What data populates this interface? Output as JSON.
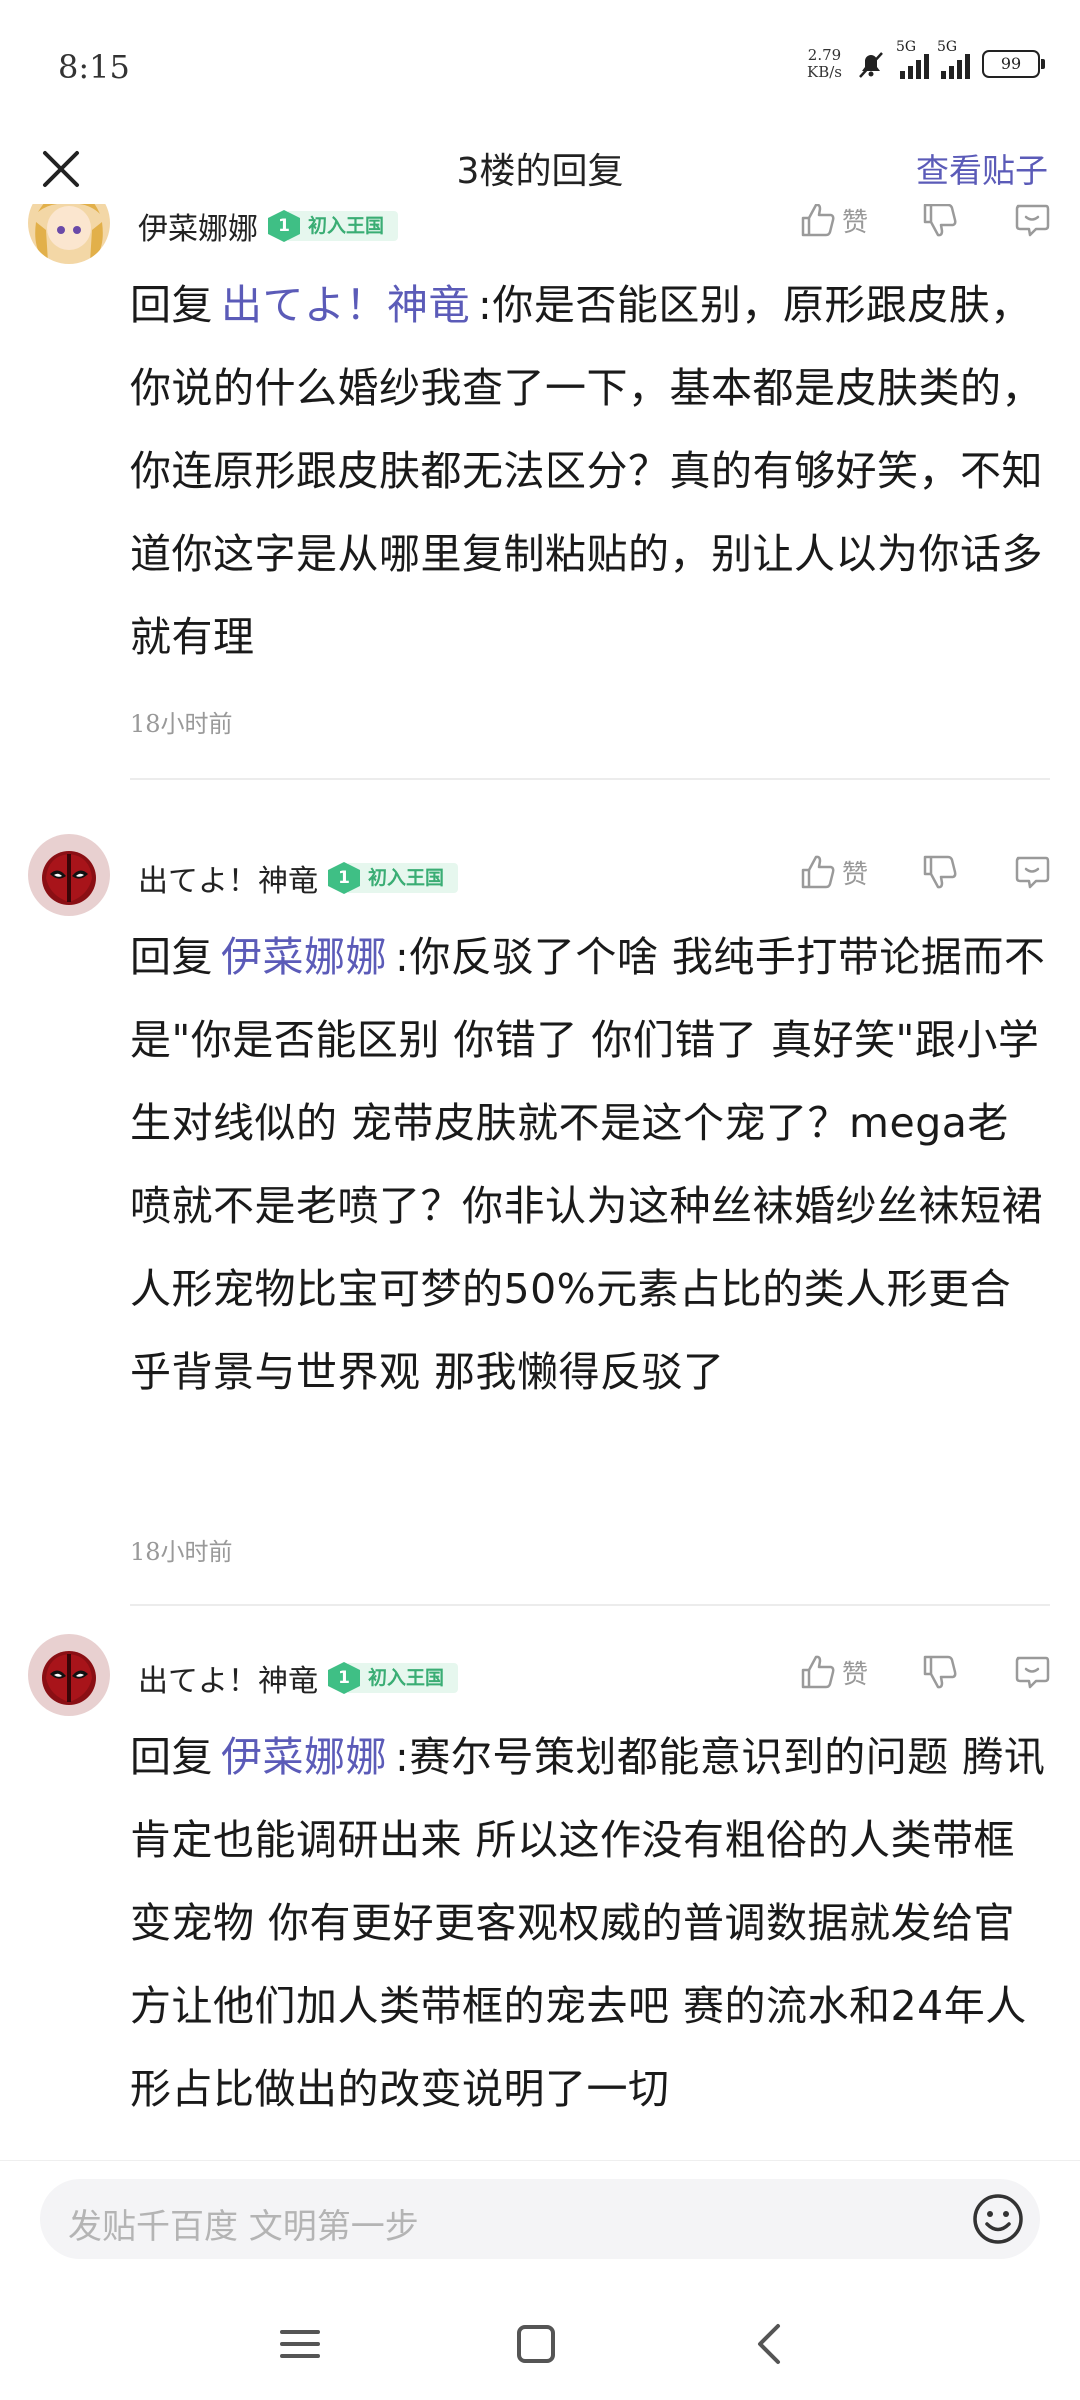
{
  "status_bar": {
    "time": "8:15",
    "speed_value": "2.79",
    "speed_unit": "KB/s",
    "net1": "5G",
    "net2": "5G",
    "battery": "99"
  },
  "header": {
    "title": "3楼的回复",
    "view_post": "查看贴子"
  },
  "comments": [
    {
      "username": "伊菜娜娜",
      "level": "1",
      "level_name": "初入王国",
      "like_label": "赞",
      "reply_prefix": "回复",
      "mention": "出てよ！神竜",
      "text": ":你是否能区别，原形跟皮肤，你说的什么婚纱我查了一下，基本都是皮肤类的，你连原形跟皮肤都无法区分？真的有够好笑，不知道你这字是从哪里复制粘贴的，别让人以为你话多就有理",
      "time": "18小时前"
    },
    {
      "username": "出てよ！神竜",
      "level": "1",
      "level_name": "初入王国",
      "like_label": "赞",
      "reply_prefix": "回复",
      "mention": "伊菜娜娜",
      "text": ":你反驳了个啥 我纯手打带论据而不是\"你是否能区别 你错了 你们错了 真好笑\"跟小学生对线似的 宠带皮肤就不是这个宠了？mega老喷就不是老喷了？你非认为这种丝袜婚纱丝袜短裙人形宠物比宝可梦的50%元素占比的类人形更合乎背景与世界观 那我懒得反驳了",
      "time": "18小时前"
    },
    {
      "username": "出てよ！神竜",
      "level": "1",
      "level_name": "初入王国",
      "like_label": "赞",
      "reply_prefix": "回复",
      "mention": "伊菜娜娜",
      "text": ":赛尔号策划都能意识到的问题 腾讯肯定也能调研出来 所以这作没有粗俗的人类带框变宠物 你有更好更客观权威的普调数据就发给官方让他们加人类带框的宠去吧 赛的流水和24年人形占比做出的改变说明了一切",
      "time": ""
    }
  ],
  "input": {
    "placeholder": "发贴千百度 文明第一步"
  },
  "icons": {
    "close": "close-icon",
    "like": "thumbs-up-icon",
    "dislike": "thumbs-down-icon",
    "reply": "comment-icon",
    "emoji": "smiley-icon",
    "nav_menu": "menu-icon",
    "nav_home": "home-icon",
    "nav_back": "back-icon"
  },
  "colors": {
    "accent": "#5b5bb8",
    "level_green": "#3fbf85",
    "muted_text": "#999999"
  }
}
